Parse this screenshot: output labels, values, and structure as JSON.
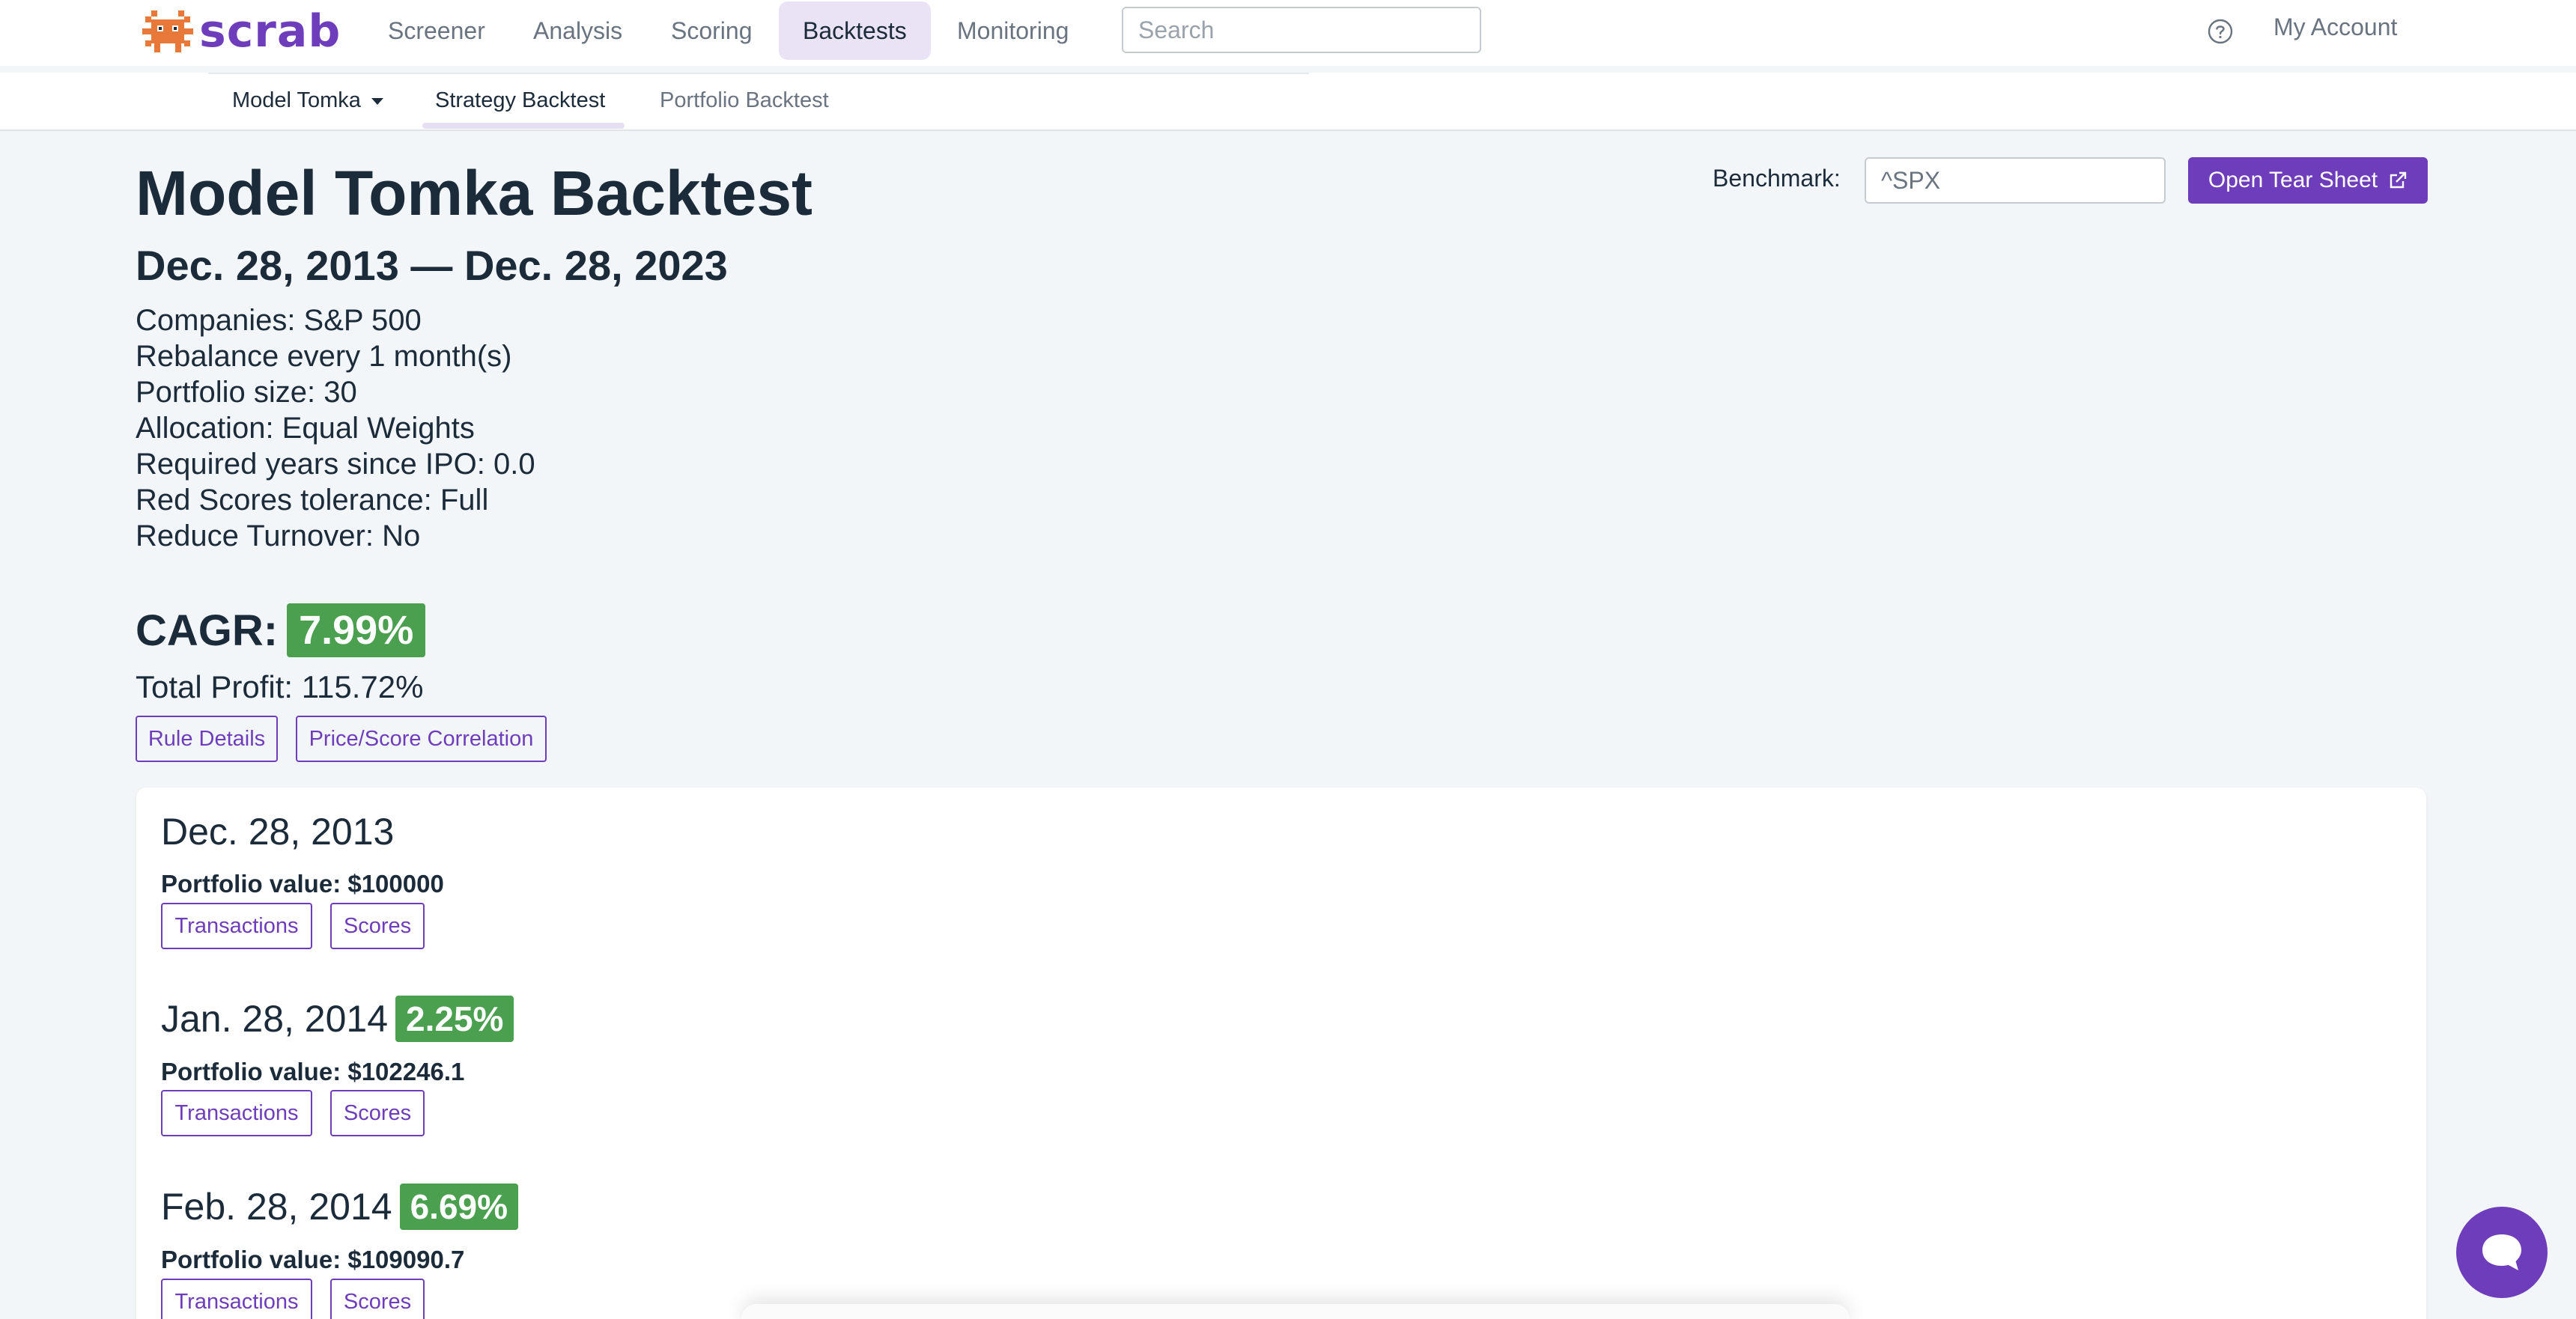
{
  "brand": {
    "name": "scrab",
    "accent": "#6e3dbb",
    "success": "#4aa04f"
  },
  "nav": {
    "items": [
      {
        "label": "Screener",
        "active": false
      },
      {
        "label": "Analysis",
        "active": false
      },
      {
        "label": "Scoring",
        "active": false
      },
      {
        "label": "Backtests",
        "active": true
      },
      {
        "label": "Monitoring",
        "active": false
      }
    ],
    "search_placeholder": "Search",
    "help_icon": "question-circle-icon",
    "account_label": "My Account"
  },
  "subnav": {
    "model_label": "Model Tomka",
    "strategy_label": "Strategy Backtest",
    "portfolio_label": "Portfolio Backtest"
  },
  "header": {
    "title": "Model Tomka Backtest",
    "date_range": "Dec. 28, 2013 — Dec. 28, 2023",
    "meta": [
      "Companies: S&P 500",
      "Rebalance every 1 month(s)",
      "Portfolio size: 30",
      "Allocation: Equal Weights",
      "Required years since IPO: 0.0",
      "Red Scores tolerance: Full",
      "Reduce Turnover: No"
    ],
    "benchmark_label": "Benchmark:",
    "benchmark_value": "^SPX",
    "tear_sheet_label": "Open Tear Sheet"
  },
  "summary": {
    "cagr_label": "CAGR:",
    "cagr_value": "7.99%",
    "total_profit": "Total Profit: 115.72%",
    "rule_details_label": "Rule Details",
    "correlation_label": "Price/Score Correlation"
  },
  "rebalances": [
    {
      "date": "Dec. 28, 2013",
      "change": null,
      "portfolio_value": "Portfolio value: $100000",
      "transactions_label": "Transactions",
      "scores_label": "Scores"
    },
    {
      "date": "Jan. 28, 2014",
      "change": "2.25%",
      "portfolio_value": "Portfolio value: $102246.1",
      "transactions_label": "Transactions",
      "scores_label": "Scores"
    },
    {
      "date": "Feb. 28, 2014",
      "change": "6.69%",
      "portfolio_value": "Portfolio value: $109090.7",
      "transactions_label": "Transactions",
      "scores_label": "Scores"
    }
  ]
}
